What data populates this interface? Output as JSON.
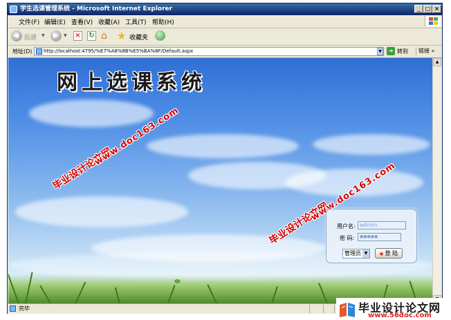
{
  "window": {
    "title": "学生选课管理系统 - Microsoft Internet Explorer",
    "min_label": "_",
    "max_label": "□",
    "close_label": "×"
  },
  "menu": [
    "文件(F)",
    "编辑(E)",
    "查看(V)",
    "收藏(A)",
    "工具(T)",
    "帮助(H)"
  ],
  "toolbar": {
    "back_label": "后退",
    "favorites_label": "收藏夹"
  },
  "address": {
    "label": "地址(D)",
    "url": "http://localhost:4795/%E7%A8%8B%E5%BA%8F/Default.aspx",
    "go_label": "转到",
    "links_label": "链接"
  },
  "page": {
    "heading": "网上选课系统",
    "watermark_cn": "毕业设计论文网",
    "watermark_url": "www.doc163.com"
  },
  "login": {
    "username_label": "用户名:",
    "username_value": "admin",
    "password_label": "密 码:",
    "password_value": "●●●●●",
    "role_value": "管理员",
    "submit_label": "登 陆"
  },
  "status": {
    "text": "完毕"
  },
  "branding": {
    "name": "毕业设计论文网",
    "url": "www.56doc.com"
  },
  "colors": {
    "titlebar": "#0a246a",
    "watermark": "#d40000"
  }
}
